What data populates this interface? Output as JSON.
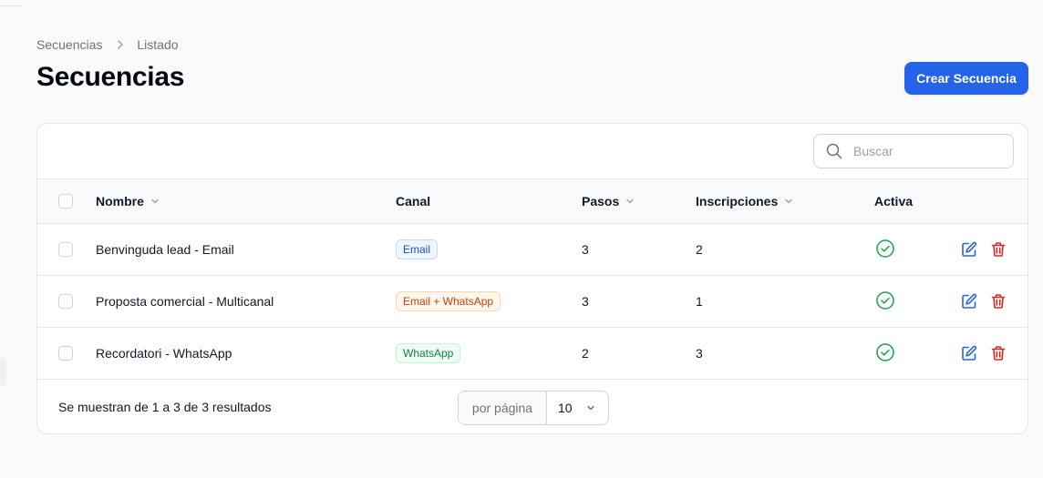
{
  "breadcrumb": {
    "root": "Secuencias",
    "current": "Listado"
  },
  "page": {
    "title": "Secuencias",
    "create_button": "Crear Secuencia"
  },
  "search": {
    "placeholder": "Buscar"
  },
  "table": {
    "headers": {
      "name": "Nombre",
      "canal": "Canal",
      "pasos": "Pasos",
      "inscripciones": "Inscripciones",
      "activa": "Activa"
    },
    "rows": [
      {
        "name": "Benvinguda lead - Email",
        "canal": "Email",
        "canal_color": "blue",
        "pasos": "3",
        "inscripciones": "2",
        "activa": true
      },
      {
        "name": "Proposta comercial - Multicanal",
        "canal": "Email + WhatsApp",
        "canal_color": "orange",
        "pasos": "3",
        "inscripciones": "1",
        "activa": true
      },
      {
        "name": "Recordatori - WhatsApp",
        "canal": "WhatsApp",
        "canal_color": "green",
        "pasos": "2",
        "inscripciones": "3",
        "activa": true
      }
    ]
  },
  "footer": {
    "results_text": "Se muestran de 1 a 3 de 3 resultados",
    "per_page_label": "por página",
    "per_page_value": "10"
  },
  "icons": {
    "search": "search-icon",
    "sort": "chevron-down-icon",
    "active": "check-circle-icon",
    "edit": "edit-icon",
    "delete": "trash-icon"
  },
  "colors": {
    "primary": "#2563eb",
    "active_green": "#16a34a",
    "edit_blue": "#2563eb",
    "delete_red": "#dc2626"
  }
}
